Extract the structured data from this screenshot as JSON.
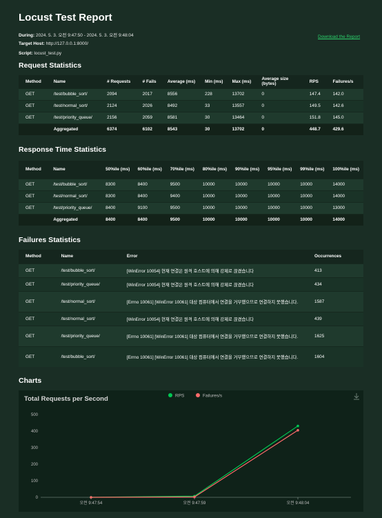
{
  "report": {
    "title": "Locust Test Report",
    "during_label": "During:",
    "during_value": "2024. 5. 3. 오전 9:47:50 - 2024. 5. 3. 오전 9:48:04",
    "host_label": "Target Host:",
    "host_value": "http://127.0.0.1:8000/",
    "script_label": "Script:",
    "script_value": "locust_test.py",
    "download_label": "Download the Report"
  },
  "request_stats": {
    "heading": "Request Statistics",
    "columns": [
      "Method",
      "Name",
      "# Requests",
      "# Fails",
      "Average (ms)",
      "Min (ms)",
      "Max (ms)",
      "Average size (bytes)",
      "RPS",
      "Failures/s"
    ],
    "rows": [
      [
        "GET",
        "/test/bubble_sort/",
        "2094",
        "2017",
        "8556",
        "228",
        "13702",
        "0",
        "147.4",
        "142.0"
      ],
      [
        "GET",
        "/test/normal_sort/",
        "2124",
        "2026",
        "8492",
        "33",
        "13557",
        "0",
        "149.5",
        "142.6"
      ],
      [
        "GET",
        "/test/priority_queue/",
        "2156",
        "2059",
        "8581",
        "30",
        "13464",
        "0",
        "151.8",
        "145.0"
      ]
    ],
    "aggregated": [
      "",
      "Aggregated",
      "6374",
      "6102",
      "8543",
      "30",
      "13702",
      "0",
      "448.7",
      "429.6"
    ]
  },
  "response_stats": {
    "heading": "Response Time Statistics",
    "columns": [
      "Method",
      "Name",
      "50%ile (ms)",
      "60%ile (ms)",
      "70%ile (ms)",
      "80%ile (ms)",
      "90%ile (ms)",
      "95%ile (ms)",
      "99%ile (ms)",
      "100%ile (ms)"
    ],
    "rows": [
      [
        "GET",
        "/test/bubble_sort/",
        "8300",
        "8400",
        "9500",
        "10000",
        "10000",
        "10000",
        "10000",
        "14000"
      ],
      [
        "GET",
        "/test/normal_sort/",
        "8300",
        "8400",
        "9400",
        "10000",
        "10000",
        "10000",
        "10000",
        "14000"
      ],
      [
        "GET",
        "/test/priority_queue/",
        "8400",
        "9100",
        "9500",
        "10000",
        "10000",
        "10000",
        "10000",
        "13000"
      ]
    ],
    "aggregated": [
      "",
      "Aggregated",
      "8400",
      "8400",
      "9500",
      "10000",
      "10000",
      "10000",
      "10000",
      "14000"
    ]
  },
  "failures_stats": {
    "heading": "Failures Statistics",
    "columns": [
      "Method",
      "Name",
      "Error",
      "Occurrences"
    ],
    "rows": [
      [
        "GET",
        "/test/bubble_sort/",
        "[WinError 10054] 현재 연결은 원격 호스트에 의해 강제로 끊겼습니다",
        "413"
      ],
      [
        "GET",
        "/test/priority_queue/",
        "[WinError 10054] 현재 연결은 원격 호스트에 의해 강제로 끊겼습니다",
        "434"
      ],
      [
        "GET",
        "/test/normal_sort/",
        "[Errno 10061] [WinError 10061] 대상 컴퓨터에서 연결을 거부했으므로 연결하지 못했습니다.",
        "1587"
      ],
      [
        "GET",
        "/test/normal_sort/",
        "[WinError 10054] 현재 연결은 원격 호스트에 의해 강제로 끊겼습니다",
        "439"
      ],
      [
        "GET",
        "/test/priority_queue/",
        "[Errno 10061] [WinError 10061] 대상 컴퓨터에서 연결을 거부했으므로 연결하지 못했습니다.",
        "1625"
      ],
      [
        "GET",
        "/test/bubble_sort/",
        "[Errno 10061] [WinError 10061] 대상 컴퓨터에서 연결을 거부했으므로 연결하지 못했습니다.",
        "1604"
      ]
    ]
  },
  "charts": {
    "heading": "Charts",
    "download_icon": "download-icon"
  },
  "chart_data": {
    "type": "line",
    "title": "Total Requests per Second",
    "x": [
      "오전 9:47:54",
      "오전 9:47:59",
      "오전 9:48:04"
    ],
    "ylim": [
      0,
      500
    ],
    "yticks": [
      0,
      100,
      200,
      300,
      400,
      500
    ],
    "grid": false,
    "legend": "top",
    "series": [
      {
        "name": "RPS",
        "color": "#00c853",
        "values": [
          0,
          7,
          431
        ]
      },
      {
        "name": "Failures/s",
        "color": "#ff6b6b",
        "values": [
          0,
          2,
          405
        ]
      }
    ]
  }
}
